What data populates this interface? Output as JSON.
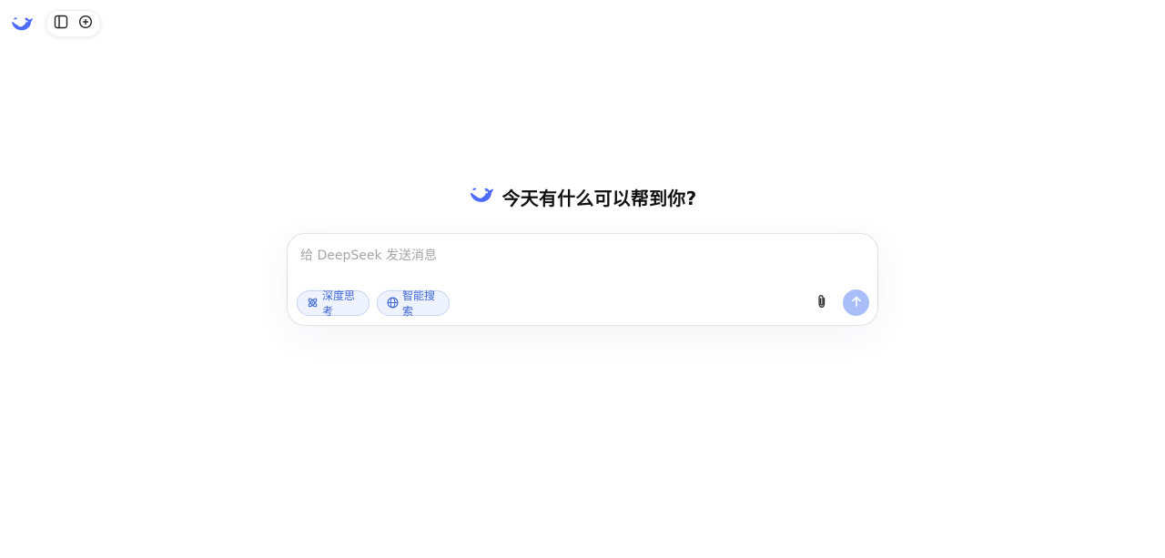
{
  "app": {
    "accent_color": "#4d6bfe",
    "send_disabled_color": "#a9bdf8"
  },
  "toolbar": {
    "logo_icon": "deepseek-whale-icon",
    "sidebar_toggle_icon": "sidebar-panel-icon",
    "new_chat_icon": "plus-circle-icon"
  },
  "main": {
    "greeting": "今天有什么可以帮到你?",
    "greeting_icon": "deepseek-whale-icon"
  },
  "composer": {
    "placeholder": "给 DeepSeek 发送消息",
    "value": "",
    "deep_think_label": "深度思考",
    "deep_think_icon": "atom-icon",
    "web_search_label": "智能搜索",
    "web_search_icon": "globe-icon",
    "attach_icon": "paperclip-icon",
    "send_icon": "arrow-up-icon"
  }
}
